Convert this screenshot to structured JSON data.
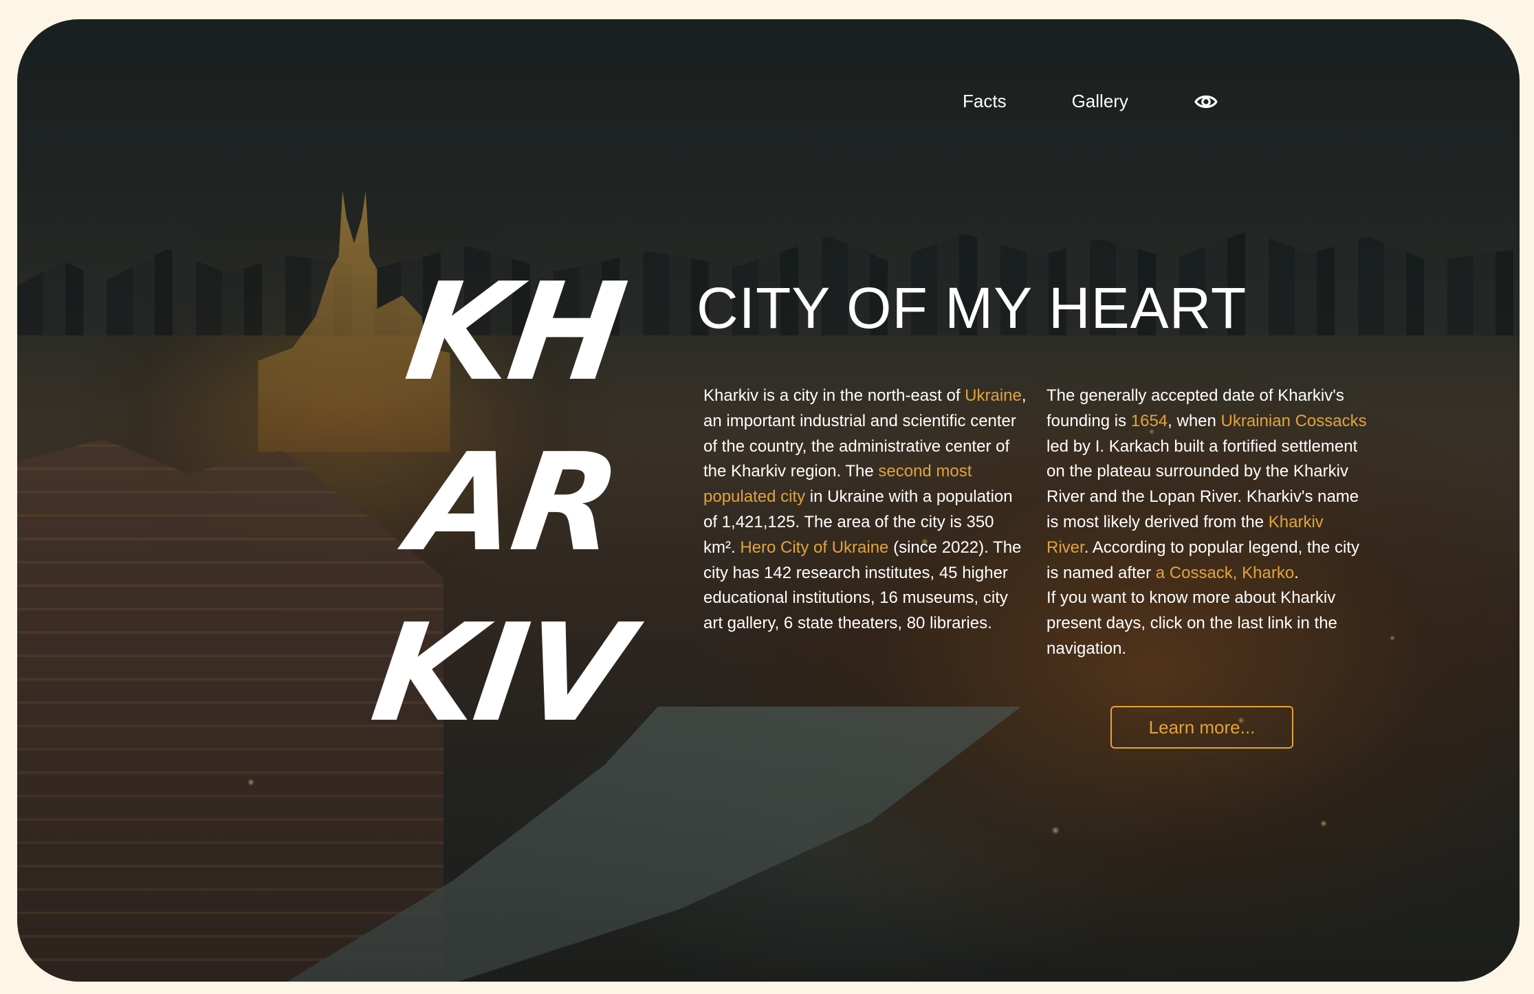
{
  "nav": {
    "facts_label": "Facts",
    "gallery_label": "Gallery"
  },
  "hero": {
    "brand_lines": [
      "KH",
      "AR",
      "KIV"
    ],
    "headline": "CITY OF MY HEART",
    "accent_color": "#e2a43a",
    "background_color": "#fdf6e7"
  },
  "left_paragraph": {
    "t1": "Kharkiv is a city in the north-east of ",
    "link1": "Ukraine",
    "t2": ", an important industrial and scientific center of the country, the administrative center of the Kharkiv region. The ",
    "link2": "second most populated city",
    "t3": " in Ukraine with a population of 1,421,125. The area of the city is 350 km². ",
    "link3": "Hero City of Ukraine",
    "t4": " (since 2022). The city has 142 research institutes, 45 higher educational institutions, 16 museums, city art gallery, 6 state theaters, 80 libraries."
  },
  "right_paragraph": {
    "t1": "The generally accepted date of Kharkiv's founding is ",
    "link1": "1654",
    "t2": ", when ",
    "link2": "Ukrainian Cossacks",
    "t3": " led by I. Karkach built a fortified settlement on the plateau surrounded by the Kharkiv River and the Lopan River. Kharkiv's name is most likely derived from the ",
    "link3": "Kharkiv River",
    "t4": ". According to popular legend, the city is named after ",
    "link4": "a Cossack, Kharko",
    "t5": ".",
    "t6": "If you want to know more about Kharkiv present days, click on the last link in the navigation."
  },
  "cta": {
    "label": "Learn more..."
  },
  "icons": {
    "nav_eye": "eye-icon"
  }
}
